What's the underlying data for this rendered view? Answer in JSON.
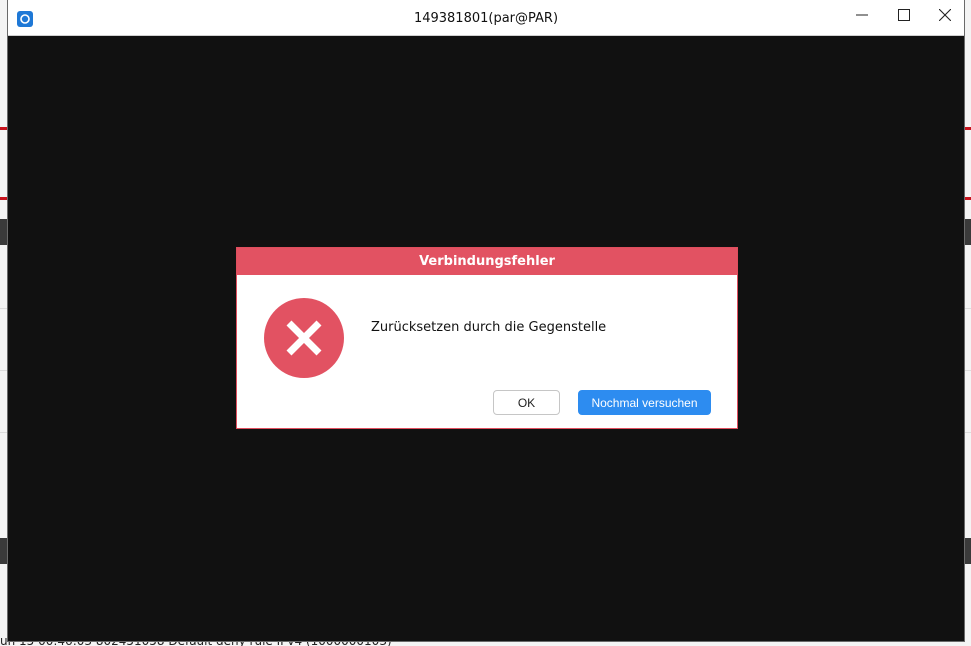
{
  "window": {
    "title": "149381801(par@PAR)",
    "controls": {
      "minimize_icon": "minimize-icon",
      "maximize_icon": "maximize-icon",
      "close_icon": "close-icon"
    }
  },
  "dialog": {
    "title": "Verbindungsfehler",
    "message": "Zurücksetzen durch die Gegenstelle",
    "icon": "error-x-icon",
    "buttons": {
      "ok": "OK",
      "retry": "Nochmal versuchen"
    }
  },
  "background": {
    "partial_row_text": "un 15 00:46:03   802451058   Default deny rule IPv4 (1000000103)"
  },
  "colors": {
    "dialog_accent": "#e25262",
    "primary_button": "#2d8cf0",
    "window_body": "#111111"
  }
}
